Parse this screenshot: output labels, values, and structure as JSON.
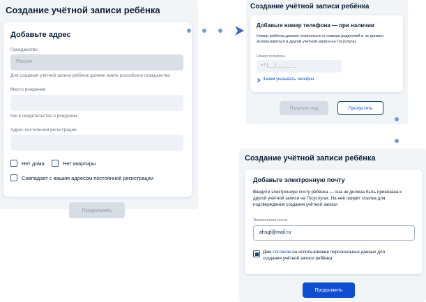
{
  "left": {
    "page_title": "Создание учётной записи ребёнка",
    "card_title": "Добавьте адрес",
    "citizenship_label": "Гражданство",
    "citizenship_value": "Россия",
    "citizenship_hint": "Для создания учётной записи ребёнок должен иметь российское гражданство",
    "birthplace_label": "Место рождения",
    "birthplace_hint": "Как в свидетельстве о рождении",
    "address_label": "Адрес постоянной регистрации",
    "no_house_label": "Нет дома",
    "no_apartment_label": "Нет квартиры",
    "same_address_label": "Совпадает с вашим адресом постоянной регистрации",
    "continue_label": "Продолжить"
  },
  "top_right": {
    "page_title": "Создание учётной записи ребёнка",
    "card_title": "Добавьте номер телефона — при наличии",
    "description_line1": "Номер ребёнка должен отличаться от номера родителей и не должен",
    "description_line2": "использоваться в другой учётной записи на Госуслугах",
    "phone_label": "Номер телефона",
    "phone_placeholder": "+7 (___) ___-__-__",
    "why_link": "Зачем указывать телефон",
    "get_code_label": "Получить код",
    "skip_label": "Пропустить"
  },
  "bottom_right": {
    "page_title": "Создание учётной записи ребёнка",
    "card_title": "Добавьте электронную почту",
    "description_line1": "Введите электронную почту ребёнка — она не должна быть привязана к",
    "description_line2": "другой учётной записи на Госуслугах. На неё придёт ссылка для",
    "description_line3": "подтверждения создания учётной записи",
    "email_label": "Электронная почта",
    "email_value": "ahsgf@mail.ru",
    "consent_prefix": "Даю ",
    "consent_link": "согласие",
    "consent_suffix": " на использование персональных данных для",
    "consent_line2": "создания учётной записи ребёнка",
    "continue_label": "Продолжить"
  },
  "colors": {
    "primary": "#0d4cd3",
    "connector": "#7b98d9",
    "panel_bg": "#f2f5f8",
    "field_bg": "#eef2f7"
  },
  "icons": [
    "arrow-right-icon",
    "arrow-down-icon",
    "chevron-right-icon",
    "checkbox-checked-icon"
  ]
}
